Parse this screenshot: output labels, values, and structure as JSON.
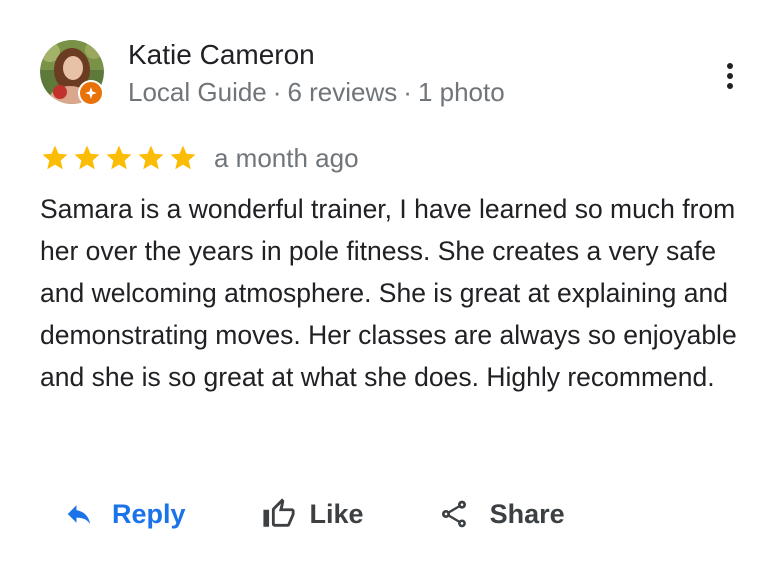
{
  "reviewer": {
    "name": "Katie Cameron",
    "badge": "Local Guide",
    "separator": "·",
    "reviews": "6 reviews",
    "photos": "1 photo",
    "avatar_icon": "profile-photo",
    "badge_icon": "local-guide-star-icon"
  },
  "review": {
    "rating": 5,
    "max_rating": 5,
    "star_color": "#fbbc04",
    "date": "a month ago",
    "text": "Samara is a wonderful trainer, I have learned so much from her over the years in pole fitness. She creates a very safe and welcoming atmosphere. She is great at explaining and demonstrating moves. Her classes are always so enjoyable and she is so great at what she does. Highly recommend."
  },
  "menu": {
    "icon": "more-vert-icon"
  },
  "actions": {
    "reply": {
      "label": "Reply",
      "icon": "reply-icon",
      "color": "#1a73e8"
    },
    "like": {
      "label": "Like",
      "icon": "thumb-up-icon"
    },
    "share": {
      "label": "Share",
      "icon": "share-icon"
    }
  }
}
